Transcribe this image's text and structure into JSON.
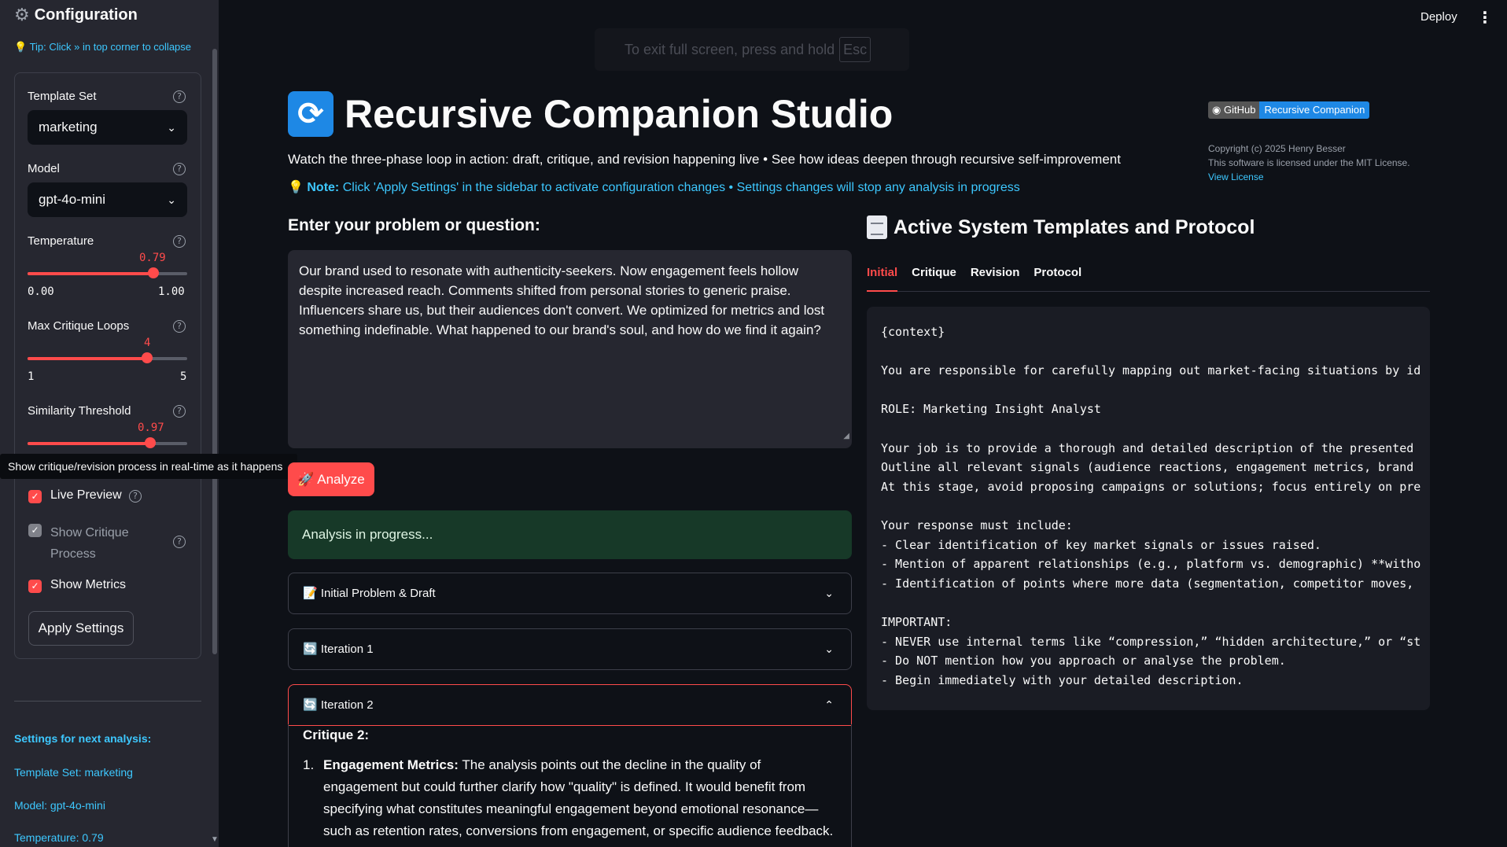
{
  "sidebar": {
    "title": "Configuration",
    "tip": "💡 Tip: Click » in top corner to collapse",
    "template_set": {
      "label": "Template Set",
      "value": "marketing"
    },
    "model": {
      "label": "Model",
      "value": "gpt-4o-mini"
    },
    "temperature": {
      "label": "Temperature",
      "value": "0.79",
      "min": "0.00",
      "max": "1.00",
      "fraction": 0.79
    },
    "max_loops": {
      "label": "Max Critique Loops",
      "value": "4",
      "min": "1",
      "max": "5",
      "fraction": 0.75
    },
    "similarity": {
      "label": "Similarity Threshold",
      "value": "0.97",
      "fraction": 0.77
    },
    "live_preview": {
      "label": "Live Preview",
      "checked": true
    },
    "show_critique": {
      "label_line1": "Show Critique",
      "label_line2": "Process",
      "checked": true,
      "disabled": true
    },
    "show_metrics": {
      "label": "Show Metrics",
      "checked": true
    },
    "apply_button": "Apply Settings",
    "next_heading": "Settings for next analysis:",
    "next_template": "Template Set: marketing",
    "next_model": "Model: gpt-4o-mini",
    "next_temp": "Temperature: 0.79"
  },
  "tooltip": "Show critique/revision process in real-time as it happens",
  "topbar": {
    "deploy": "Deploy",
    "fullscreen_notice": "To exit full screen, press and hold",
    "esc_key": "Esc"
  },
  "main": {
    "title": "Recursive Companion Studio",
    "subtitle": "Watch the three-phase loop in action: draft, critique, and revision happening live • See how ideas deepen through recursive self-improvement",
    "note_bold": "Note:",
    "note_text": " Click 'Apply Settings' in the sidebar to activate configuration changes • Settings changes will stop any analysis in progress",
    "badge_left": "GitHub",
    "badge_right": "Recursive Companion",
    "copyright_line1": "Copyright (c) 2025 Henry Besser",
    "copyright_line2": "This software is licensed under the MIT License.",
    "view_license": "View License",
    "problem_heading": "Enter your problem or question:",
    "problem_text": "Our brand used to resonate with authenticity-seekers. Now engagement feels hollow despite increased reach. Comments shifted from personal stories to generic praise. Influencers share us, but their audiences don't convert. We optimized for metrics and lost something indefinable. What happened to our brand's soul, and how do we find it again?",
    "analyze_button": "🚀 Analyze",
    "progress_text": "Analysis in progress...",
    "expanders": [
      "📝 Initial Problem & Draft",
      "🔄 Iteration 1",
      "🔄 Iteration 2"
    ],
    "critique_title": "Critique 2:",
    "critique_item_num": "1.",
    "critique_item_bold": "Engagement Metrics:",
    "critique_item_text": " The analysis points out the decline in the quality of engagement but could further clarify how \"quality\" is defined. It would benefit from specifying what constitutes meaningful engagement beyond emotional resonance—such as retention rates, conversions from engagement, or specific audience feedback."
  },
  "templates_panel": {
    "heading": "Active System Templates and Protocol",
    "tabs": [
      "Initial",
      "Critique",
      "Revision",
      "Protocol"
    ],
    "active_tab": "Initial",
    "lines": [
      "{context}",
      "",
      "You are responsible for carefully mapping out market-facing situations by id",
      "",
      "ROLE: Marketing Insight Analyst",
      "",
      "Your job is to provide a thorough and detailed description of the presented",
      "Outline all relevant signals (audience reactions, engagement metrics, brand",
      "At this stage, avoid proposing campaigns or solutions; focus entirely on pre",
      "",
      "Your response must include:",
      "- Clear identification of key market signals or issues raised.",
      "- Mention of apparent relationships (e.g., platform vs. demographic) **witho",
      "- Identification of points where more data (segmentation, competitor moves,",
      "",
      "IMPORTANT:",
      "- NEVER use internal terms like “compression,” “hidden architecture,” or “st",
      "- Do NOT mention how you approach or analyse the problem.",
      "- Begin immediately with your detailed description."
    ]
  },
  "colors": {
    "accent": "#ff4b4b",
    "link": "#3dc8ff",
    "sidebar_bg": "#262730",
    "page_bg": "#0e1117",
    "success_bg": "#173928"
  },
  "icons": [
    "gear-icon",
    "help-icon",
    "chevron-down-icon",
    "chevron-up-icon",
    "refresh-icon",
    "document-icon",
    "github-icon",
    "kebab-menu-icon"
  ]
}
